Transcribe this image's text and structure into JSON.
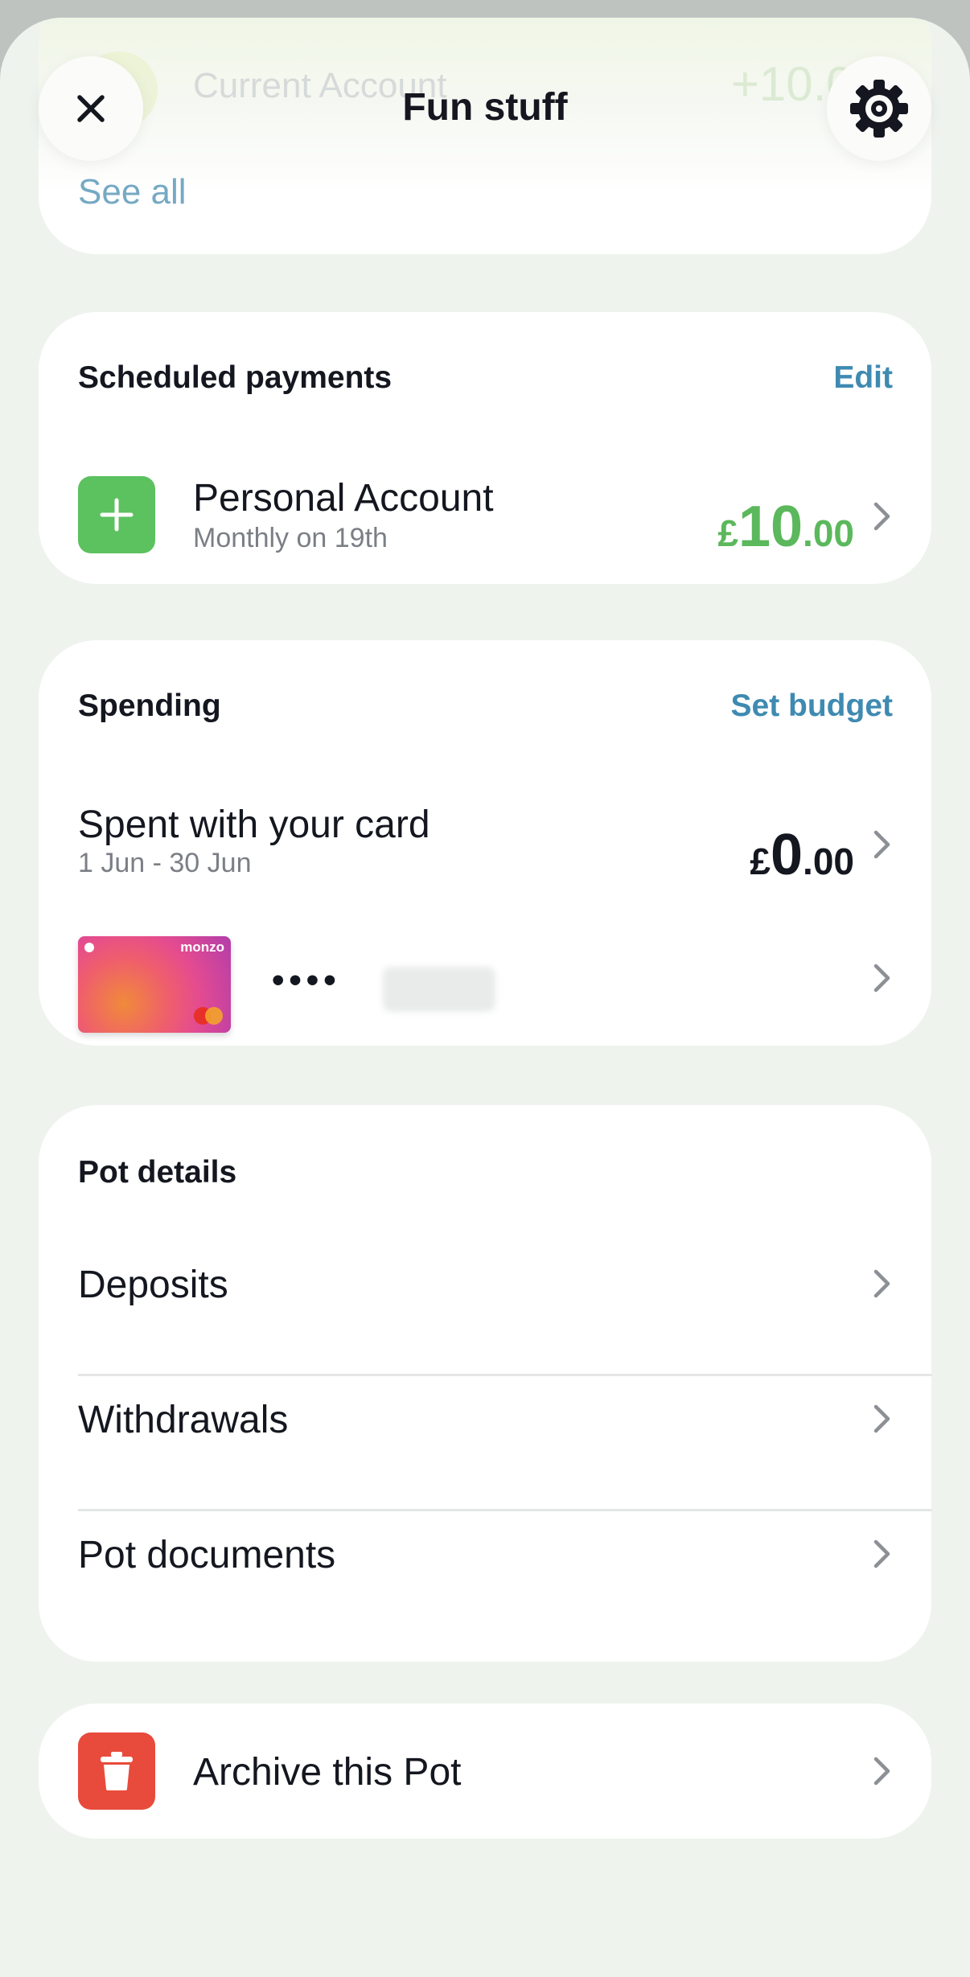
{
  "header": {
    "title": "Fun stuff"
  },
  "top_card": {
    "ghost_title": "Current Account",
    "ghost_amount": "+10.00",
    "see_all": "See all"
  },
  "scheduled": {
    "title": "Scheduled payments",
    "edit": "Edit",
    "payment": {
      "name": "Personal Account",
      "sub": "Monthly on 19th",
      "currency": "£",
      "amount_major": "10",
      "amount_minor": ".00"
    }
  },
  "spending": {
    "title": "Spending",
    "set_budget": "Set budget",
    "row_title": "Spent with your card",
    "row_sub": "1 Jun - 30 Jun",
    "currency": "£",
    "amount_major": "0",
    "amount_minor": ".00",
    "card_brand": "monzo",
    "card_mask": "••••"
  },
  "pot_details": {
    "title": "Pot details",
    "items": [
      {
        "label": "Deposits"
      },
      {
        "label": "Withdrawals"
      },
      {
        "label": "Pot documents"
      }
    ]
  },
  "archive": {
    "label": "Archive this Pot"
  },
  "colors": {
    "accent_green": "#5bb85c",
    "link_blue": "#3f8ab1",
    "danger_red": "#e84b3c"
  }
}
